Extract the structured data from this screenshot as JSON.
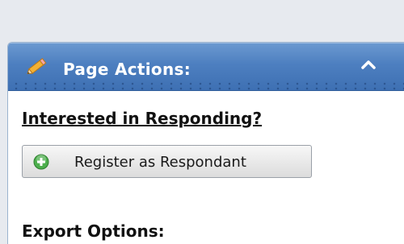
{
  "panel": {
    "title": "Page Actions:",
    "header_color": "#4d7fc0"
  },
  "respond_section": {
    "heading": "Interested in Responding?",
    "register_button_label": "Register as Respondant",
    "register_icon": "plus-circle-icon",
    "register_icon_color": "#4cae4c"
  },
  "export_section": {
    "heading": "Export Options:"
  },
  "icons": {
    "header_icon": "pencil-icon",
    "collapse_icon": "chevron-up-icon"
  }
}
